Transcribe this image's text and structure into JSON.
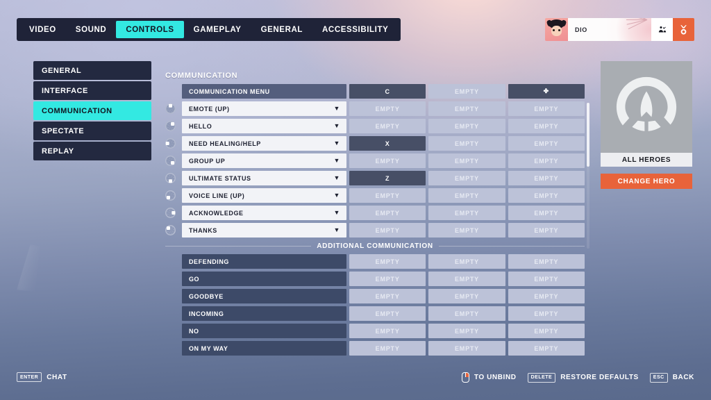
{
  "tabs": [
    {
      "label": "VIDEO",
      "active": false
    },
    {
      "label": "SOUND",
      "active": false
    },
    {
      "label": "CONTROLS",
      "active": true
    },
    {
      "label": "GAMEPLAY",
      "active": false
    },
    {
      "label": "GENERAL",
      "active": false
    },
    {
      "label": "ACCESSIBILITY",
      "active": false
    }
  ],
  "player": {
    "name": "DIO",
    "social_icon": "group-icon",
    "badge_icon": "medal-icon"
  },
  "sidebar": {
    "items": [
      {
        "label": "GENERAL",
        "active": false
      },
      {
        "label": "INTERFACE",
        "active": false
      },
      {
        "label": "COMMUNICATION",
        "active": true
      },
      {
        "label": "SPECTATE",
        "active": false
      },
      {
        "label": "REPLAY",
        "active": false
      }
    ]
  },
  "main": {
    "section_title": "COMMUNICATION",
    "additional_title": "ADDITIONAL COMMUNICATION",
    "empty_label": "EMPTY",
    "header_row": {
      "label": "COMMUNICATION MENU",
      "binds": [
        "C",
        "EMPTY",
        "✤"
      ],
      "bind_states": [
        "set",
        "empty",
        "set"
      ]
    },
    "wheel_rows": [
      {
        "label": "EMOTE (UP)",
        "wheel_angle": 0,
        "binds": [
          "EMPTY",
          "EMPTY",
          "EMPTY"
        ],
        "bind_states": [
          "empty",
          "empty",
          "empty"
        ]
      },
      {
        "label": "HELLO",
        "wheel_angle": 45,
        "binds": [
          "EMPTY",
          "EMPTY",
          "EMPTY"
        ],
        "bind_states": [
          "empty",
          "empty",
          "empty"
        ]
      },
      {
        "label": "NEED HEALING/HELP",
        "wheel_angle": 270,
        "binds": [
          "X",
          "EMPTY",
          "EMPTY"
        ],
        "bind_states": [
          "set",
          "empty",
          "empty"
        ]
      },
      {
        "label": "GROUP UP",
        "wheel_angle": 135,
        "binds": [
          "EMPTY",
          "EMPTY",
          "EMPTY"
        ],
        "bind_states": [
          "empty",
          "empty",
          "empty"
        ]
      },
      {
        "label": "ULTIMATE STATUS",
        "wheel_angle": 180,
        "binds": [
          "Z",
          "EMPTY",
          "EMPTY"
        ],
        "bind_states": [
          "set",
          "empty",
          "empty"
        ]
      },
      {
        "label": "VOICE LINE (UP)",
        "wheel_angle": 225,
        "binds": [
          "EMPTY",
          "EMPTY",
          "EMPTY"
        ],
        "bind_states": [
          "empty",
          "empty",
          "empty"
        ]
      },
      {
        "label": "ACKNOWLEDGE",
        "wheel_angle": 90,
        "binds": [
          "EMPTY",
          "EMPTY",
          "EMPTY"
        ],
        "bind_states": [
          "empty",
          "empty",
          "empty"
        ]
      },
      {
        "label": "THANKS",
        "wheel_angle": 315,
        "binds": [
          "EMPTY",
          "EMPTY",
          "EMPTY"
        ],
        "bind_states": [
          "empty",
          "empty",
          "empty"
        ]
      }
    ],
    "additional_rows": [
      {
        "label": "DEFENDING",
        "binds": [
          "EMPTY",
          "EMPTY",
          "EMPTY"
        ]
      },
      {
        "label": "GO",
        "binds": [
          "EMPTY",
          "EMPTY",
          "EMPTY"
        ]
      },
      {
        "label": "GOODBYE",
        "binds": [
          "EMPTY",
          "EMPTY",
          "EMPTY"
        ]
      },
      {
        "label": "INCOMING",
        "binds": [
          "EMPTY",
          "EMPTY",
          "EMPTY"
        ]
      },
      {
        "label": "NO",
        "binds": [
          "EMPTY",
          "EMPTY",
          "EMPTY"
        ]
      },
      {
        "label": "ON MY WAY",
        "binds": [
          "EMPTY",
          "EMPTY",
          "EMPTY"
        ]
      }
    ]
  },
  "hero": {
    "logo_icon": "overwatch-logo-icon",
    "name": "ALL HEROES",
    "change_button": "CHANGE HERO"
  },
  "bottom": {
    "left": [
      {
        "key": "ENTER",
        "label": "CHAT"
      }
    ],
    "right": [
      {
        "key": "",
        "icon": "mouse-right-click-icon",
        "label": "TO UNBIND"
      },
      {
        "key": "DELETE",
        "label": "RESTORE DEFAULTS"
      },
      {
        "key": "ESC",
        "label": "BACK"
      }
    ]
  },
  "colors": {
    "accent_cyan": "#33e9e2",
    "accent_orange": "#e8633a",
    "panel_dark": "#232940",
    "bind_set": "#474f66",
    "bind_empty": "#bcc2d8"
  }
}
